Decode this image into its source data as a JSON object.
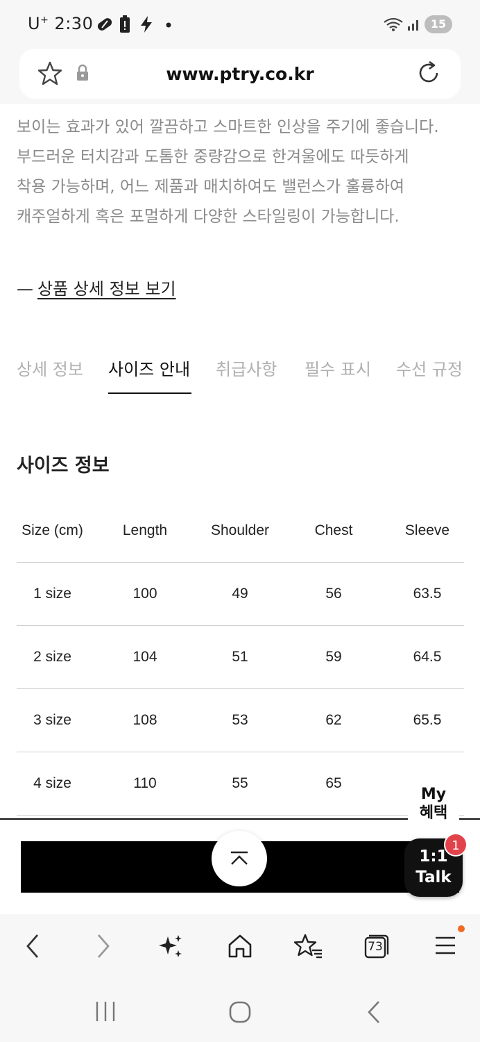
{
  "status_bar": {
    "carrier": "U",
    "carrier_sup": "+",
    "time": "2:30",
    "battery_level": "15",
    "icons": [
      "pill-icon",
      "battery-alert-icon",
      "bolt-icon",
      "dot-icon",
      "wifi-icon",
      "signal-icon"
    ]
  },
  "browser": {
    "url": "www.ptry.co.kr"
  },
  "product": {
    "description_lines": [
      "보이는 효과가 있어 깔끔하고 스마트한 인상을 주기에 좋습니다.",
      "부드러운 터치감과 도톰한 중량감으로 한겨울에도 따듯하게",
      "착용 가능하며, 어느 제품과 매치하여도 밸런스가 훌륭하여",
      "캐주얼하게 혹은 포멀하게 다양한 스타일링이 가능합니다."
    ],
    "detail_link_dash": "—",
    "detail_link": "상품 상세 정보 보기"
  },
  "tabs": [
    {
      "label": "상세 정보",
      "active": false
    },
    {
      "label": "사이즈 안내",
      "active": true
    },
    {
      "label": "취급사항",
      "active": false
    },
    {
      "label": "필수 표시",
      "active": false
    },
    {
      "label": "수선 규정",
      "active": false
    }
  ],
  "size_info": {
    "title": "사이즈 정보",
    "headers": [
      "Size (cm)",
      "Length",
      "Shoulder",
      "Chest",
      "Sleeve"
    ],
    "rows": [
      [
        "1 size",
        "100",
        "49",
        "56",
        "63.5"
      ],
      [
        "2 size",
        "104",
        "51",
        "59",
        "64.5"
      ],
      [
        "3 size",
        "108",
        "53",
        "62",
        "65.5"
      ],
      [
        "4 size",
        "110",
        "55",
        "65",
        ""
      ]
    ]
  },
  "floating": {
    "my_benefit_line1": "My",
    "my_benefit_line2": "혜택",
    "talk_line1": "1:1",
    "talk_line2": "Talk",
    "talk_badge": "1"
  },
  "toolbar": {
    "tab_count": "73",
    "icons": [
      "back-icon",
      "forward-icon",
      "sparkle-icon",
      "home-icon",
      "bookmarks-icon",
      "tabs-icon",
      "menu-icon"
    ]
  },
  "colors": {
    "accent_badge": "#e2434b",
    "menu_dot": "#f26a21",
    "buy_bar": "#000000"
  }
}
